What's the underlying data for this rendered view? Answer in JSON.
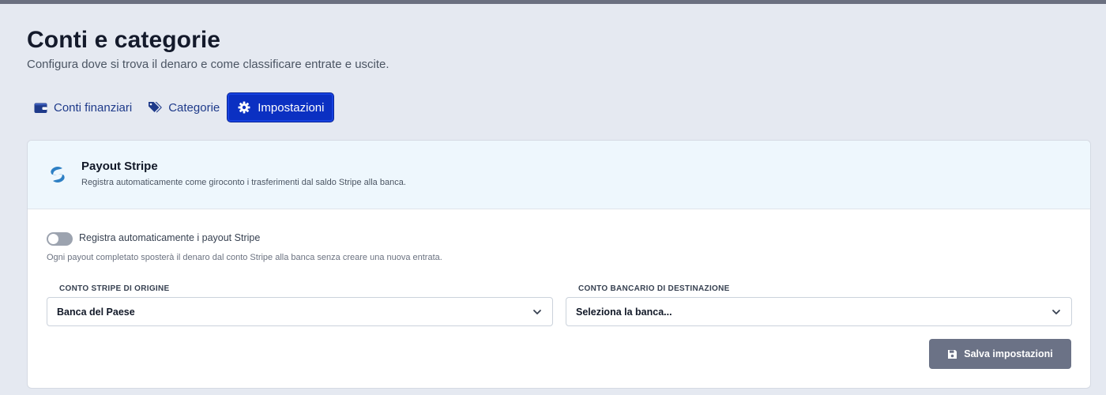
{
  "page": {
    "title": "Conti e categorie",
    "subtitle": "Configura dove si trova il denaro e come classificare entrate e uscite."
  },
  "tabs": [
    {
      "label": "Conti finanziari",
      "icon": "wallet-icon",
      "active": false
    },
    {
      "label": "Categorie",
      "icon": "tags-icon",
      "active": false
    },
    {
      "label": "Impostazioni",
      "icon": "gear-icon",
      "active": true
    }
  ],
  "card": {
    "title": "Payout Stripe",
    "description": "Registra automaticamente come giroconto i trasferimenti dal saldo Stripe alla banca.",
    "icon": "stripe-logo-icon"
  },
  "toggle": {
    "label": "Registra automaticamente i payout Stripe",
    "enabled": false,
    "help": "Ogni payout completato sposterà il denaro dal conto Stripe alla banca senza creare una nuova entrata."
  },
  "fields": {
    "origin": {
      "label": "CONTO STRIPE DI ORIGINE",
      "value": "Banca del Paese"
    },
    "destination": {
      "label": "CONTO BANCARIO DI DESTINAZIONE",
      "value": "Seleziona la banca..."
    }
  },
  "actions": {
    "save_label": "Salva impostazioni",
    "save_icon": "floppy-disk-icon"
  },
  "colors": {
    "accent": "#0b30c2",
    "tab_text": "#1e3a8a",
    "stripe_blue": "#2d7fc4",
    "save_button": "#6b7286",
    "card_header_bg": "#eef7fd"
  }
}
